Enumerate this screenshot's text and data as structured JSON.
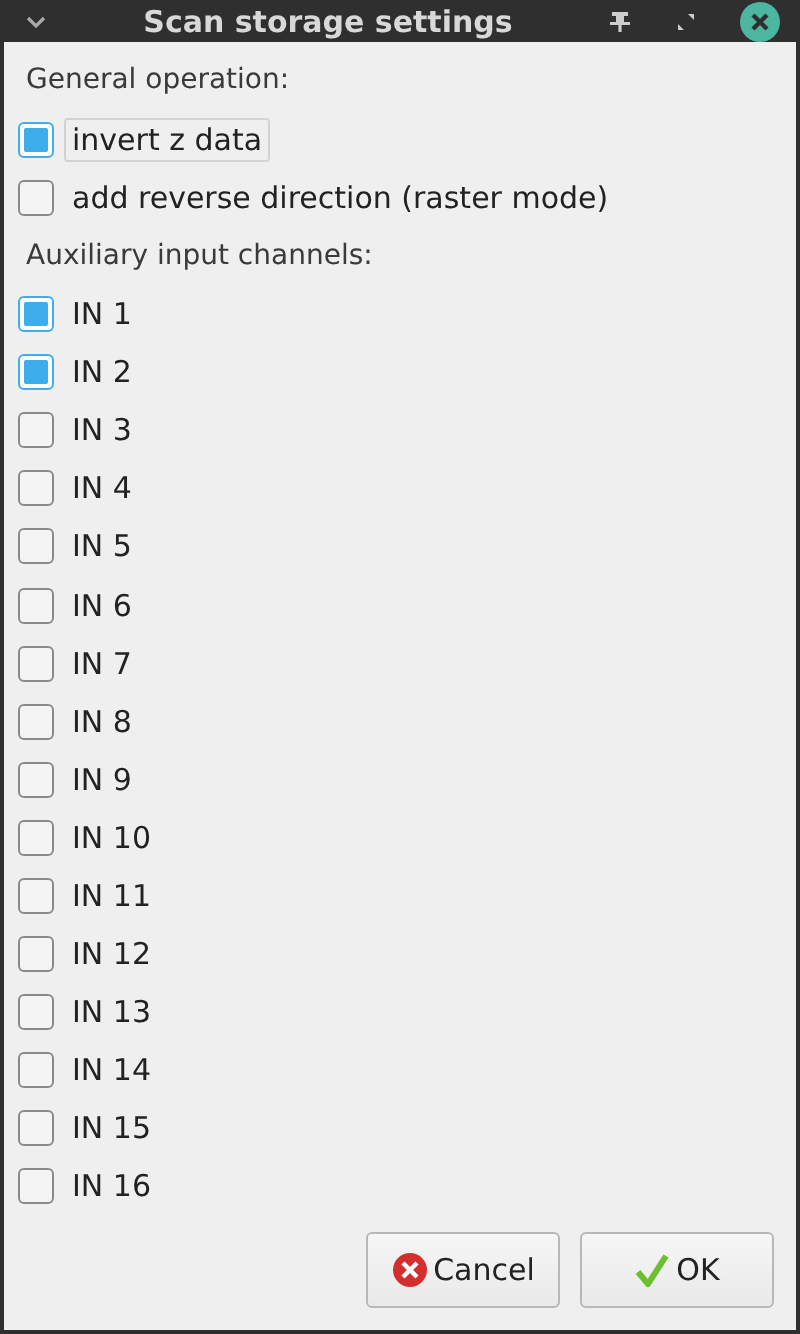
{
  "window": {
    "title": "Scan storage settings"
  },
  "sections": [
    {
      "label": "General operation:",
      "items": [
        {
          "label": "invert z data",
          "checked": true,
          "focused": true
        },
        {
          "label": "add reverse direction (raster mode)",
          "checked": false,
          "focused": false
        }
      ]
    },
    {
      "label": "Auxiliary input channels:",
      "items": [
        {
          "label": "IN 1",
          "checked": true,
          "focused": false
        },
        {
          "label": "IN 2",
          "checked": true,
          "focused": false
        },
        {
          "label": "IN 3",
          "checked": false,
          "focused": false
        },
        {
          "label": "IN 4",
          "checked": false,
          "focused": false
        },
        {
          "label": "IN 5",
          "checked": false,
          "focused": false
        },
        {
          "label": "IN 6",
          "checked": false,
          "focused": false
        },
        {
          "label": "IN 7",
          "checked": false,
          "focused": false
        },
        {
          "label": "IN 8",
          "checked": false,
          "focused": false
        },
        {
          "label": "IN 9",
          "checked": false,
          "focused": false
        },
        {
          "label": "IN 10",
          "checked": false,
          "focused": false
        },
        {
          "label": "IN 11",
          "checked": false,
          "focused": false
        },
        {
          "label": "IN 12",
          "checked": false,
          "focused": false
        },
        {
          "label": "IN 13",
          "checked": false,
          "focused": false
        },
        {
          "label": "IN 14",
          "checked": false,
          "focused": false
        },
        {
          "label": "IN 15",
          "checked": false,
          "focused": false
        },
        {
          "label": "IN 16",
          "checked": false,
          "focused": false
        }
      ]
    }
  ],
  "buttons": [
    {
      "label": "Cancel",
      "kind": "cancel"
    },
    {
      "label": "OK",
      "kind": "ok"
    }
  ]
}
